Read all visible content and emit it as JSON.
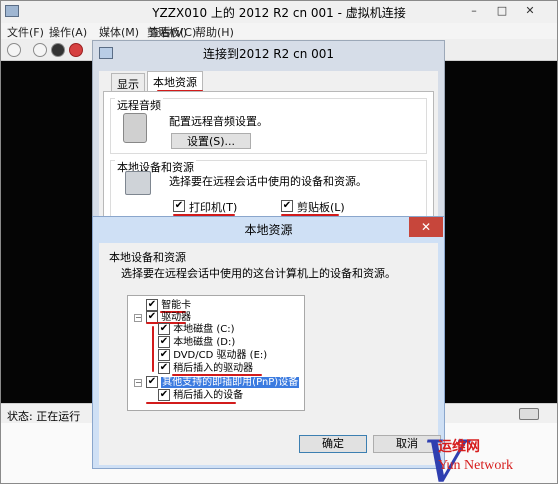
{
  "vm_window": {
    "title": "YZZX010 上的 2012 R2 cn 001 - 虚拟机连接",
    "minimize": "–",
    "maximize": "□",
    "close": "✕",
    "menu": [
      "文件(F)",
      "操作(A)",
      "媒体(M)",
      "剪贴板(C)",
      "查看(V)",
      "帮助(H)"
    ],
    "status": "状态: 正在运行"
  },
  "remote_dialog": {
    "title": "连接到2012 R2 cn 001",
    "tabs": [
      "显示",
      "本地资源"
    ],
    "audio": {
      "heading": "远程音频",
      "description": "配置远程音频设置。",
      "settings_button": "设置(S)..."
    },
    "devices": {
      "heading": "本地设备和资源",
      "description": "选择要在远程会话中使用的设备和资源。",
      "printer_label": "打印机(T)",
      "clipboard_label": "剪贴板(L)"
    }
  },
  "local_dialog": {
    "title": "本地资源",
    "close": "✕",
    "heading": "本地设备和资源",
    "description": "选择要在远程会话中使用的这台计算机上的设备和资源。",
    "tree": [
      "智能卡",
      "驱动器",
      "本地磁盘 (C:)",
      "本地磁盘 (D:)",
      "DVD/CD 驱动器 (E:)",
      "稍后插入的驱动器",
      "其他支持的即插即用(PnP)设备",
      "稍后插入的设备"
    ],
    "ok_button": "确定",
    "cancel_button": "取消"
  },
  "watermark": {
    "cn": "运维网",
    "en": "Yun Network"
  },
  "colors": {
    "highlight": "#3b7be0",
    "annotation_red": "#d21b1b",
    "close_red": "#c7463b"
  }
}
